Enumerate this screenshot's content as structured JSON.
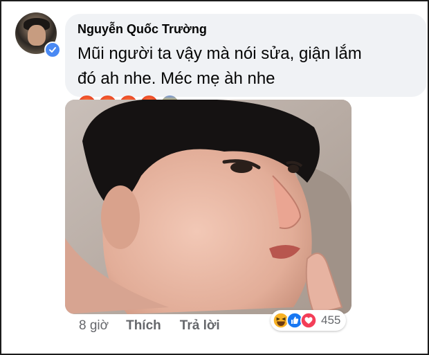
{
  "comment": {
    "author": "Nguyễn Quốc Trường",
    "text": "Mũi người ta vậy mà nói sửa, giận lắm đó ah nhe. Méc mẹ àh nhe",
    "emojis": [
      "pouting-face-icon",
      "pouting-face-icon",
      "pouting-face-icon",
      "pouting-face-icon",
      "fearful-face-icon"
    ],
    "author_verified": true
  },
  "actions": {
    "time": "8 giờ",
    "like_label": "Thích",
    "reply_label": "Trả lời"
  },
  "reactions": {
    "types": [
      "haha-reaction-icon",
      "like-reaction-icon",
      "love-reaction-icon"
    ],
    "count": "455"
  },
  "colors": {
    "bubble": "#f0f2f5",
    "verified": "#4a89f3",
    "like": "#1877f2",
    "love": "#f33e58",
    "haha": "#f7b125"
  }
}
